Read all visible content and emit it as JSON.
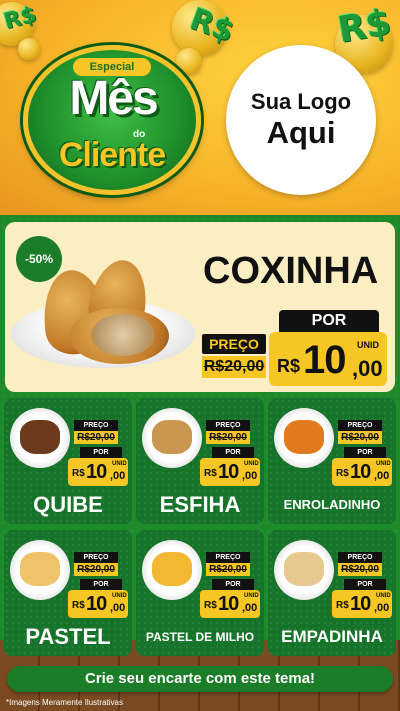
{
  "header": {
    "badge": {
      "tag": "Especial",
      "line1": "Mês",
      "line2": "do",
      "line3": "Cliente"
    },
    "logo": {
      "line1": "Sua Logo",
      "line2": "Aqui"
    },
    "decor_symbol": "R$"
  },
  "hero": {
    "discount": "-50%",
    "title": "COXINHA",
    "preco_label": "PREÇO",
    "old_price": "R$20,00",
    "por_label": "POR",
    "currency": "R$",
    "price_int": "10",
    "price_cents": ",00",
    "unit": "UNID"
  },
  "cards": [
    {
      "name": "QUIBE",
      "preco_label": "PREÇO",
      "old_price": "R$20,00",
      "por_label": "POR",
      "currency": "R$",
      "price_int": "10",
      "price_cents": ",00",
      "unit": "UNID",
      "food_color": "#6b3a1c"
    },
    {
      "name": "ESFIHA",
      "preco_label": "PREÇO",
      "old_price": "R$20,00",
      "por_label": "POR",
      "currency": "R$",
      "price_int": "10",
      "price_cents": ",00",
      "unit": "UNID",
      "food_color": "#c9974f"
    },
    {
      "name": "ENROLADINHO",
      "preco_label": "PREÇO",
      "old_price": "R$20,00",
      "por_label": "POR",
      "currency": "R$",
      "price_int": "10",
      "price_cents": ",00",
      "unit": "UNID",
      "food_color": "#e07a1c"
    },
    {
      "name": "PASTEL",
      "preco_label": "PREÇO",
      "old_price": "R$20,00",
      "por_label": "POR",
      "currency": "R$",
      "price_int": "10",
      "price_cents": ",00",
      "unit": "UNID",
      "food_color": "#f0c26a"
    },
    {
      "name": "PASTEL DE MILHO",
      "preco_label": "PREÇO",
      "old_price": "R$20,00",
      "por_label": "POR",
      "currency": "R$",
      "price_int": "10",
      "price_cents": ",00",
      "unit": "UNID",
      "food_color": "#f2b733"
    },
    {
      "name": "EMPADINHA",
      "preco_label": "PREÇO",
      "old_price": "R$20,00",
      "por_label": "POR",
      "currency": "R$",
      "price_int": "10",
      "price_cents": ",00",
      "unit": "UNID",
      "food_color": "#e6c98e"
    }
  ],
  "cta": "Crie seu encarte com este tema!",
  "disclaimer": "*Imagens Meramente Ilustrativas",
  "colors": {
    "brand_green": "#1e8a2a",
    "brand_yellow": "#f6c625",
    "header_orange": "#f7b52a"
  }
}
